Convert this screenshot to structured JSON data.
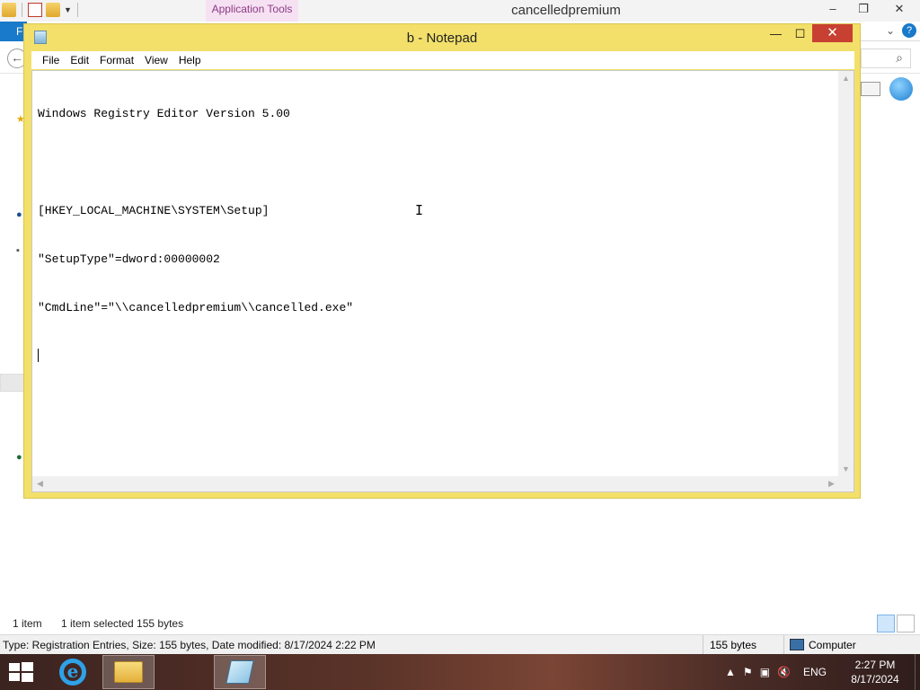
{
  "explorer": {
    "title": "cancelledpremium",
    "context_tab": "Application Tools",
    "file_tab": "F",
    "controls": {
      "minimize": "–",
      "maximize": "❐",
      "close": "✕"
    },
    "status": {
      "item_count": "1 item",
      "selected": "1 item selected  155 bytes"
    },
    "details": {
      "text": "Type: Registration Entries, Size: 155 bytes, Date modified: 8/17/2024 2:22 PM",
      "size": "155 bytes",
      "location": "Computer"
    }
  },
  "notepad": {
    "title": "b - Notepad",
    "menu": [
      "File",
      "Edit",
      "Format",
      "View",
      "Help"
    ],
    "controls": {
      "minimize": "—",
      "maximize": "☐",
      "close": "✕"
    },
    "lines": [
      "Windows Registry Editor Version 5.00",
      "",
      "[HKEY_LOCAL_MACHINE\\SYSTEM\\Setup]",
      "\"SetupType\"=dword:00000002",
      "\"CmdLine\"=\"\\\\cancelledpremium\\\\cancelled.exe\""
    ]
  },
  "taskbar": {
    "apps": [
      {
        "name": "Internet Explorer",
        "icon": "internet-explorer-icon",
        "active": false
      },
      {
        "name": "File Explorer",
        "icon": "folder-icon",
        "active": false
      },
      {
        "name": "Notepad",
        "icon": "notepad-icon",
        "active": true
      }
    ],
    "language": "ENG",
    "time": "2:27 PM",
    "date": "8/17/2024"
  }
}
